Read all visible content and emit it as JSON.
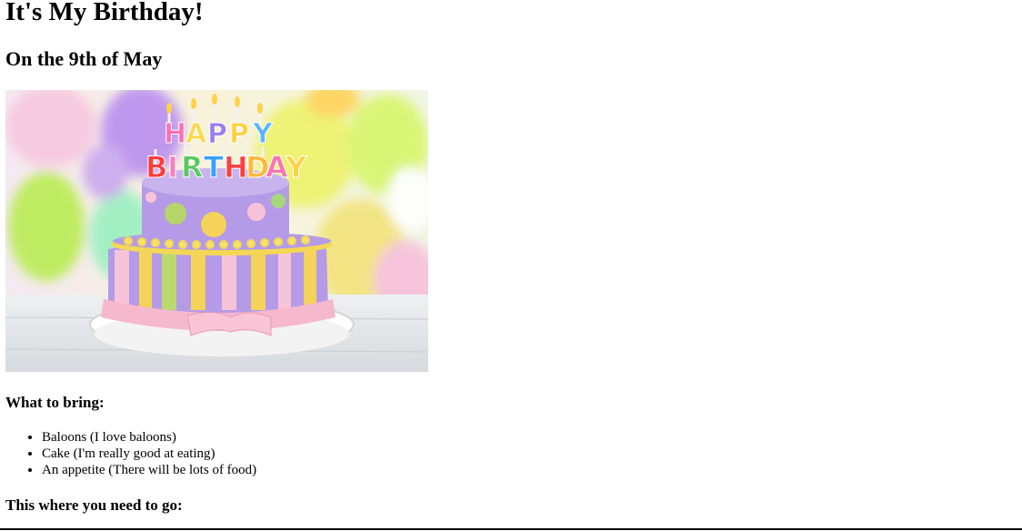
{
  "page": {
    "title": "It's My Birthday!",
    "subtitle": "On the 9th of May",
    "image_alt": "Birthday cake"
  },
  "bring": {
    "heading": "What to bring:",
    "items": [
      "Baloons (I love baloons)",
      "Cake (I'm really good at eating)",
      "An appetite (There will be lots of food)"
    ]
  },
  "directions": {
    "heading": "This where you need to go:"
  },
  "colors": {
    "cake_purple": "#b69be6",
    "cake_pink": "#f7b7cf",
    "cake_yellow": "#f3d64a",
    "cake_green": "#a8d86a"
  }
}
